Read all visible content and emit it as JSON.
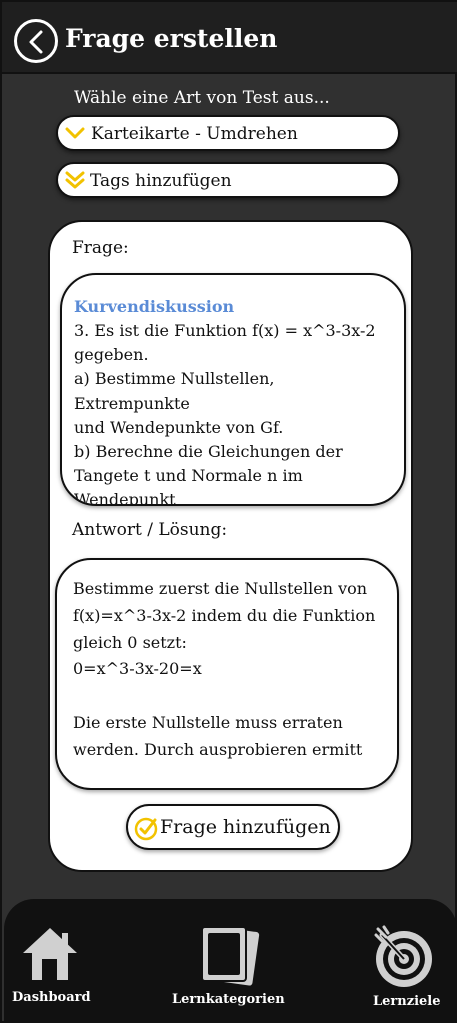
{
  "header": {
    "title": "Frage erstellen"
  },
  "selector": {
    "prompt": "Wähle eine Art von Test aus...",
    "type_label": "Karteikarte - Umdrehen",
    "tags_label": "Tags hinzufügen"
  },
  "card": {
    "question_label": "Frage:",
    "question_topic": "Kurvendiskussion",
    "question_text": "3. Es ist die Funktion f(x) = x^3-3x-2\ngegeben.\na) Bestimme Nullstellen, Extrempunkte\nund Wendepunkte von Gf.\nb) Berechne die Gleichungen der\nTangete t und Normale n im\nWendepunkt",
    "answer_label": "Antwort / Lösung:",
    "answer_text": "Bestimme zuerst die Nullstellen von\nf(x)=x^3-3x-2 indem du die Funktion\ngleich 0 setzt:\n0=x^3-3x-20=x\n\nDie erste Nullstelle muss erraten\nwerden. Durch ausprobieren ermitt",
    "add_button_label": "Frage hinzufügen"
  },
  "nav": {
    "items": [
      {
        "label": "Dashboard",
        "icon": "home-icon"
      },
      {
        "label": "Lernkategorien",
        "icon": "cards-icon"
      },
      {
        "label": "Lernziele",
        "icon": "target-icon"
      }
    ]
  },
  "colors": {
    "accent": "#f2c200",
    "topic": "#5a8bd6",
    "header_bg": "#1f1f1f",
    "nav_bg": "#111111",
    "page_bg": "#303030"
  }
}
